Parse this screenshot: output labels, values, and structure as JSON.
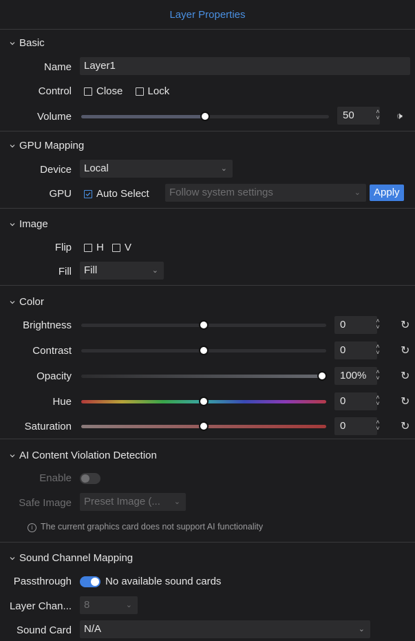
{
  "title": "Layer Properties",
  "colors": {
    "accent": "#4a90e2",
    "apply_bg": "#3f7fe0"
  },
  "basic": {
    "header": "Basic",
    "name_label": "Name",
    "name_value": "Layer1",
    "control_label": "Control",
    "close_label": "Close",
    "lock_label": "Lock",
    "volume_label": "Volume",
    "volume_value": "50",
    "volume_level": 0.5
  },
  "gpu": {
    "header": "GPU Mapping",
    "device_label": "Device",
    "device_value": "Local",
    "gpu_label": "GPU",
    "auto_select_label": "Auto Select",
    "gpu_select_placeholder": "Follow system settings",
    "apply_label": "Apply"
  },
  "image": {
    "header": "Image",
    "flip_label": "Flip",
    "flip_h": "H",
    "flip_v": "V",
    "fill_label": "Fill",
    "fill_value": "Fill"
  },
  "color": {
    "header": "Color",
    "brightness_label": "Brightness",
    "brightness_value": "0",
    "contrast_label": "Contrast",
    "contrast_value": "0",
    "opacity_label": "Opacity",
    "opacity_value": "100%",
    "hue_label": "Hue",
    "hue_value": "0",
    "saturation_label": "Saturation",
    "saturation_value": "0"
  },
  "ai": {
    "header": "AI Content Violation Detection",
    "enable_label": "Enable",
    "safe_image_label": "Safe Image",
    "safe_image_value": "Preset Image (...",
    "note": "The current graphics card does not support AI functionality"
  },
  "sound": {
    "header": "Sound Channel Mapping",
    "passthrough_label": "Passthrough",
    "passthrough_text": "No available sound cards",
    "layer_channel_label": "Layer Chan...",
    "layer_channel_value": "8",
    "sound_card_label": "Sound Card",
    "sound_card_value": "N/A"
  }
}
